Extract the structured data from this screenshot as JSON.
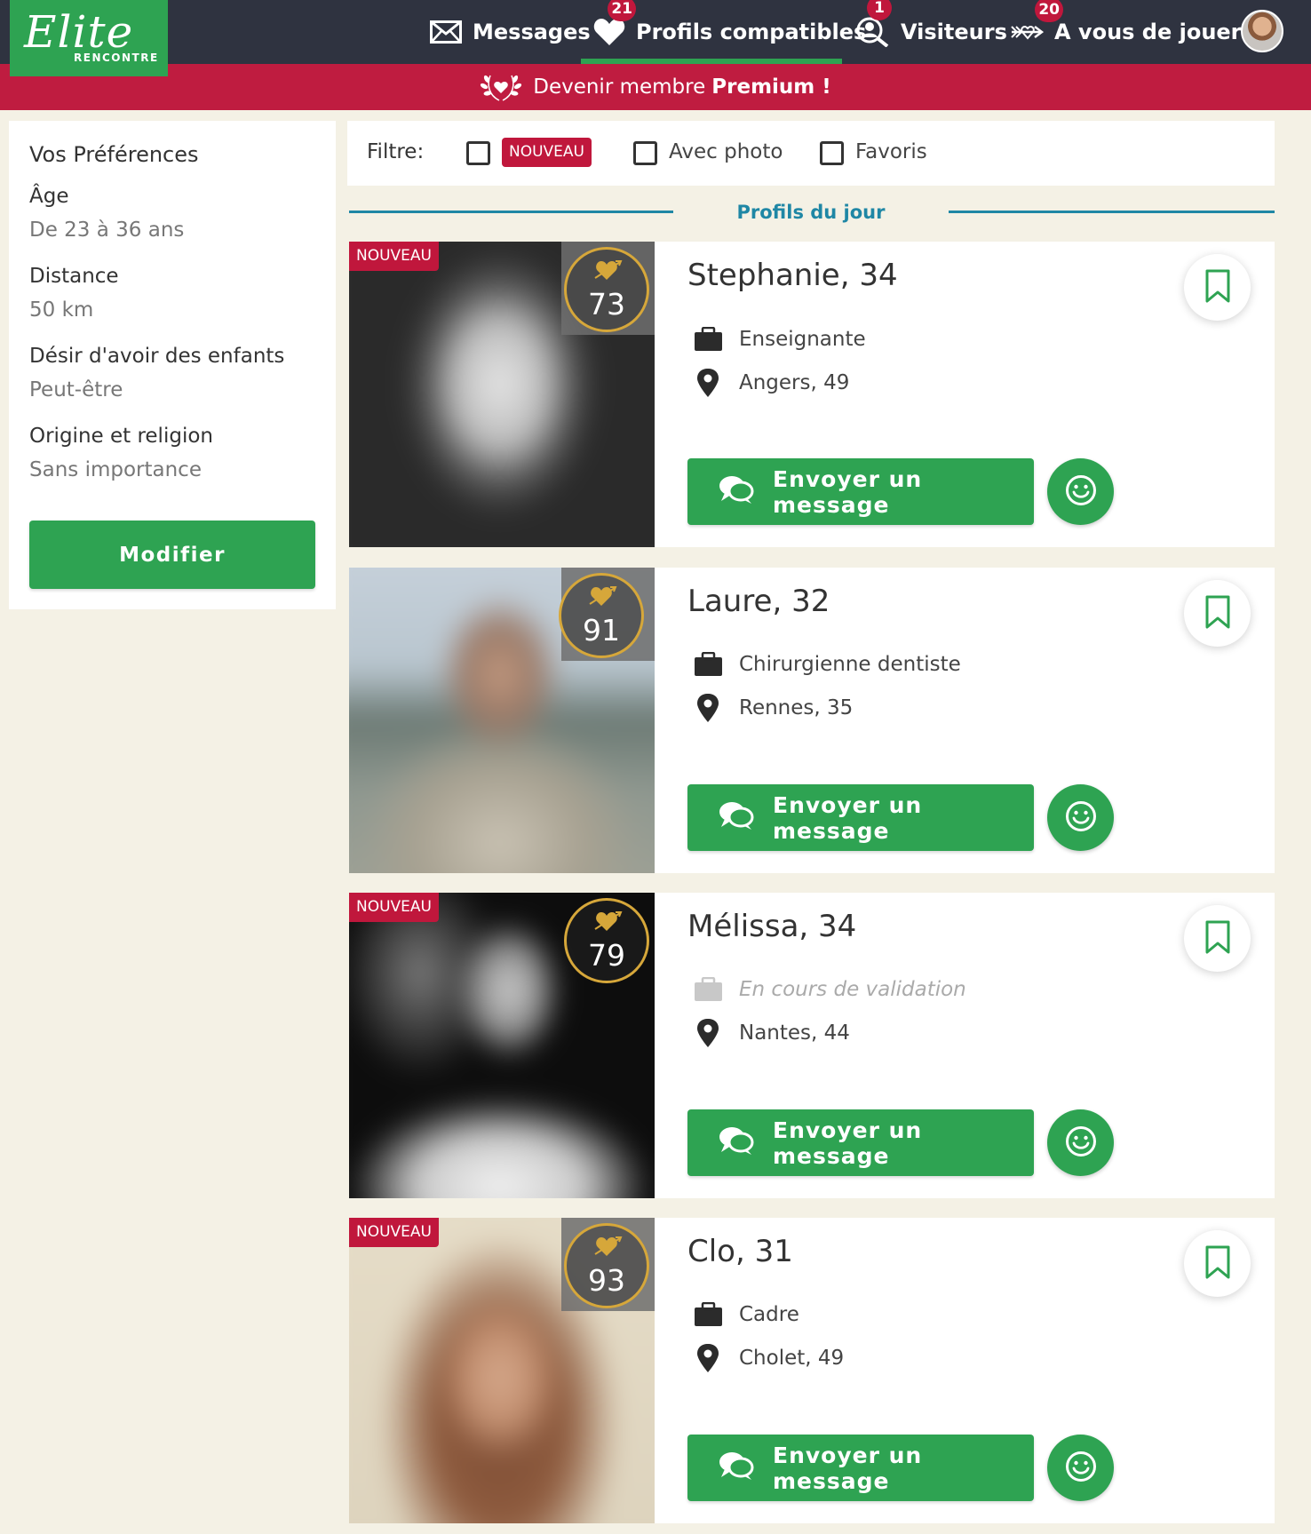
{
  "logo": {
    "main": "Elite",
    "sub": "RENCONTRE"
  },
  "nav": {
    "messages": {
      "label": "Messages"
    },
    "compatible": {
      "label": "Profils compatibles",
      "badge": "21"
    },
    "visitors": {
      "label": "Visiteurs",
      "badge": "1"
    },
    "play": {
      "label": "A vous de jouer !",
      "badge": "20"
    }
  },
  "premium": {
    "text": "Devenir membre",
    "bold": "Premium !"
  },
  "preferences": {
    "title": "Vos Préférences",
    "items": [
      {
        "label": "Âge",
        "value": "De 23 à 36 ans"
      },
      {
        "label": "Distance",
        "value": "50 km"
      },
      {
        "label": "Désir d'avoir des enfants",
        "value": "Peut-être"
      },
      {
        "label": "Origine et religion",
        "value": "Sans importance"
      }
    ],
    "modify_label": "Modifier"
  },
  "filter": {
    "label": "Filtre:",
    "new_tag": "NOUVEAU",
    "with_photo": "Avec photo",
    "favorites": "Favoris"
  },
  "section_title": "Profils du jour",
  "message_button_label": "Envoyer un message",
  "new_badge": "NOUVEAU",
  "profiles": [
    {
      "name": "Stephanie",
      "age": ", 34",
      "job": "Enseignante",
      "location": "Angers, 49",
      "score": "73",
      "is_new": true
    },
    {
      "name": "Laure",
      "age": ", 32",
      "job": "Chirurgienne dentiste",
      "location": "Rennes, 35",
      "score": "91",
      "is_new": false
    },
    {
      "name": "Mélissa",
      "age": ", 34",
      "job": "En cours de validation",
      "location": "Nantes, 44",
      "score": "79",
      "is_new": true
    },
    {
      "name": "Clo",
      "age": ", 31",
      "job": "Cadre",
      "location": "Cholet, 49",
      "score": "93",
      "is_new": true
    }
  ],
  "colors": {
    "brand_green": "#2ea352",
    "topbar": "#2f3340",
    "premium_red": "#bf1c40",
    "accent_blue": "#1f87a5",
    "score_gold": "#d6a73a"
  },
  "icons": [
    "envelope-icon",
    "heart-icon",
    "visitor-icon",
    "arrow-heart-icon",
    "laurel-heart-icon",
    "briefcase-icon",
    "location-pin-icon",
    "chat-bubbles-icon",
    "smile-icon",
    "bookmark-icon",
    "heart-arrow-icon"
  ]
}
